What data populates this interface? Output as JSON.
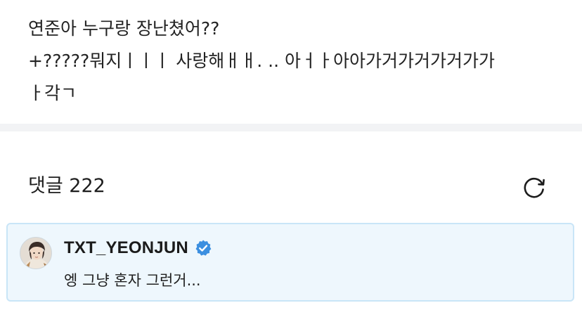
{
  "post": {
    "lines": [
      "연준아 누구랑 장난쳤어??",
      "+?????뭐지ㅣㅣㅣ 사랑해ㅐㅐ. .. 아ㅓㅏ아아가거가거가거가가",
      "ㅏ각ㄱ"
    ]
  },
  "comments": {
    "label": "댓글",
    "count": "222",
    "refresh_icon": "refresh-icon"
  },
  "comment": {
    "author": "TXT_YEONJUN",
    "verified_icon": "verified-badge-icon",
    "text": "엥 그냥 혼자 그런거...",
    "highlight_color": "#eef7fd",
    "border_color": "#c9e5f7",
    "badge_color": "#3b8fe0"
  }
}
